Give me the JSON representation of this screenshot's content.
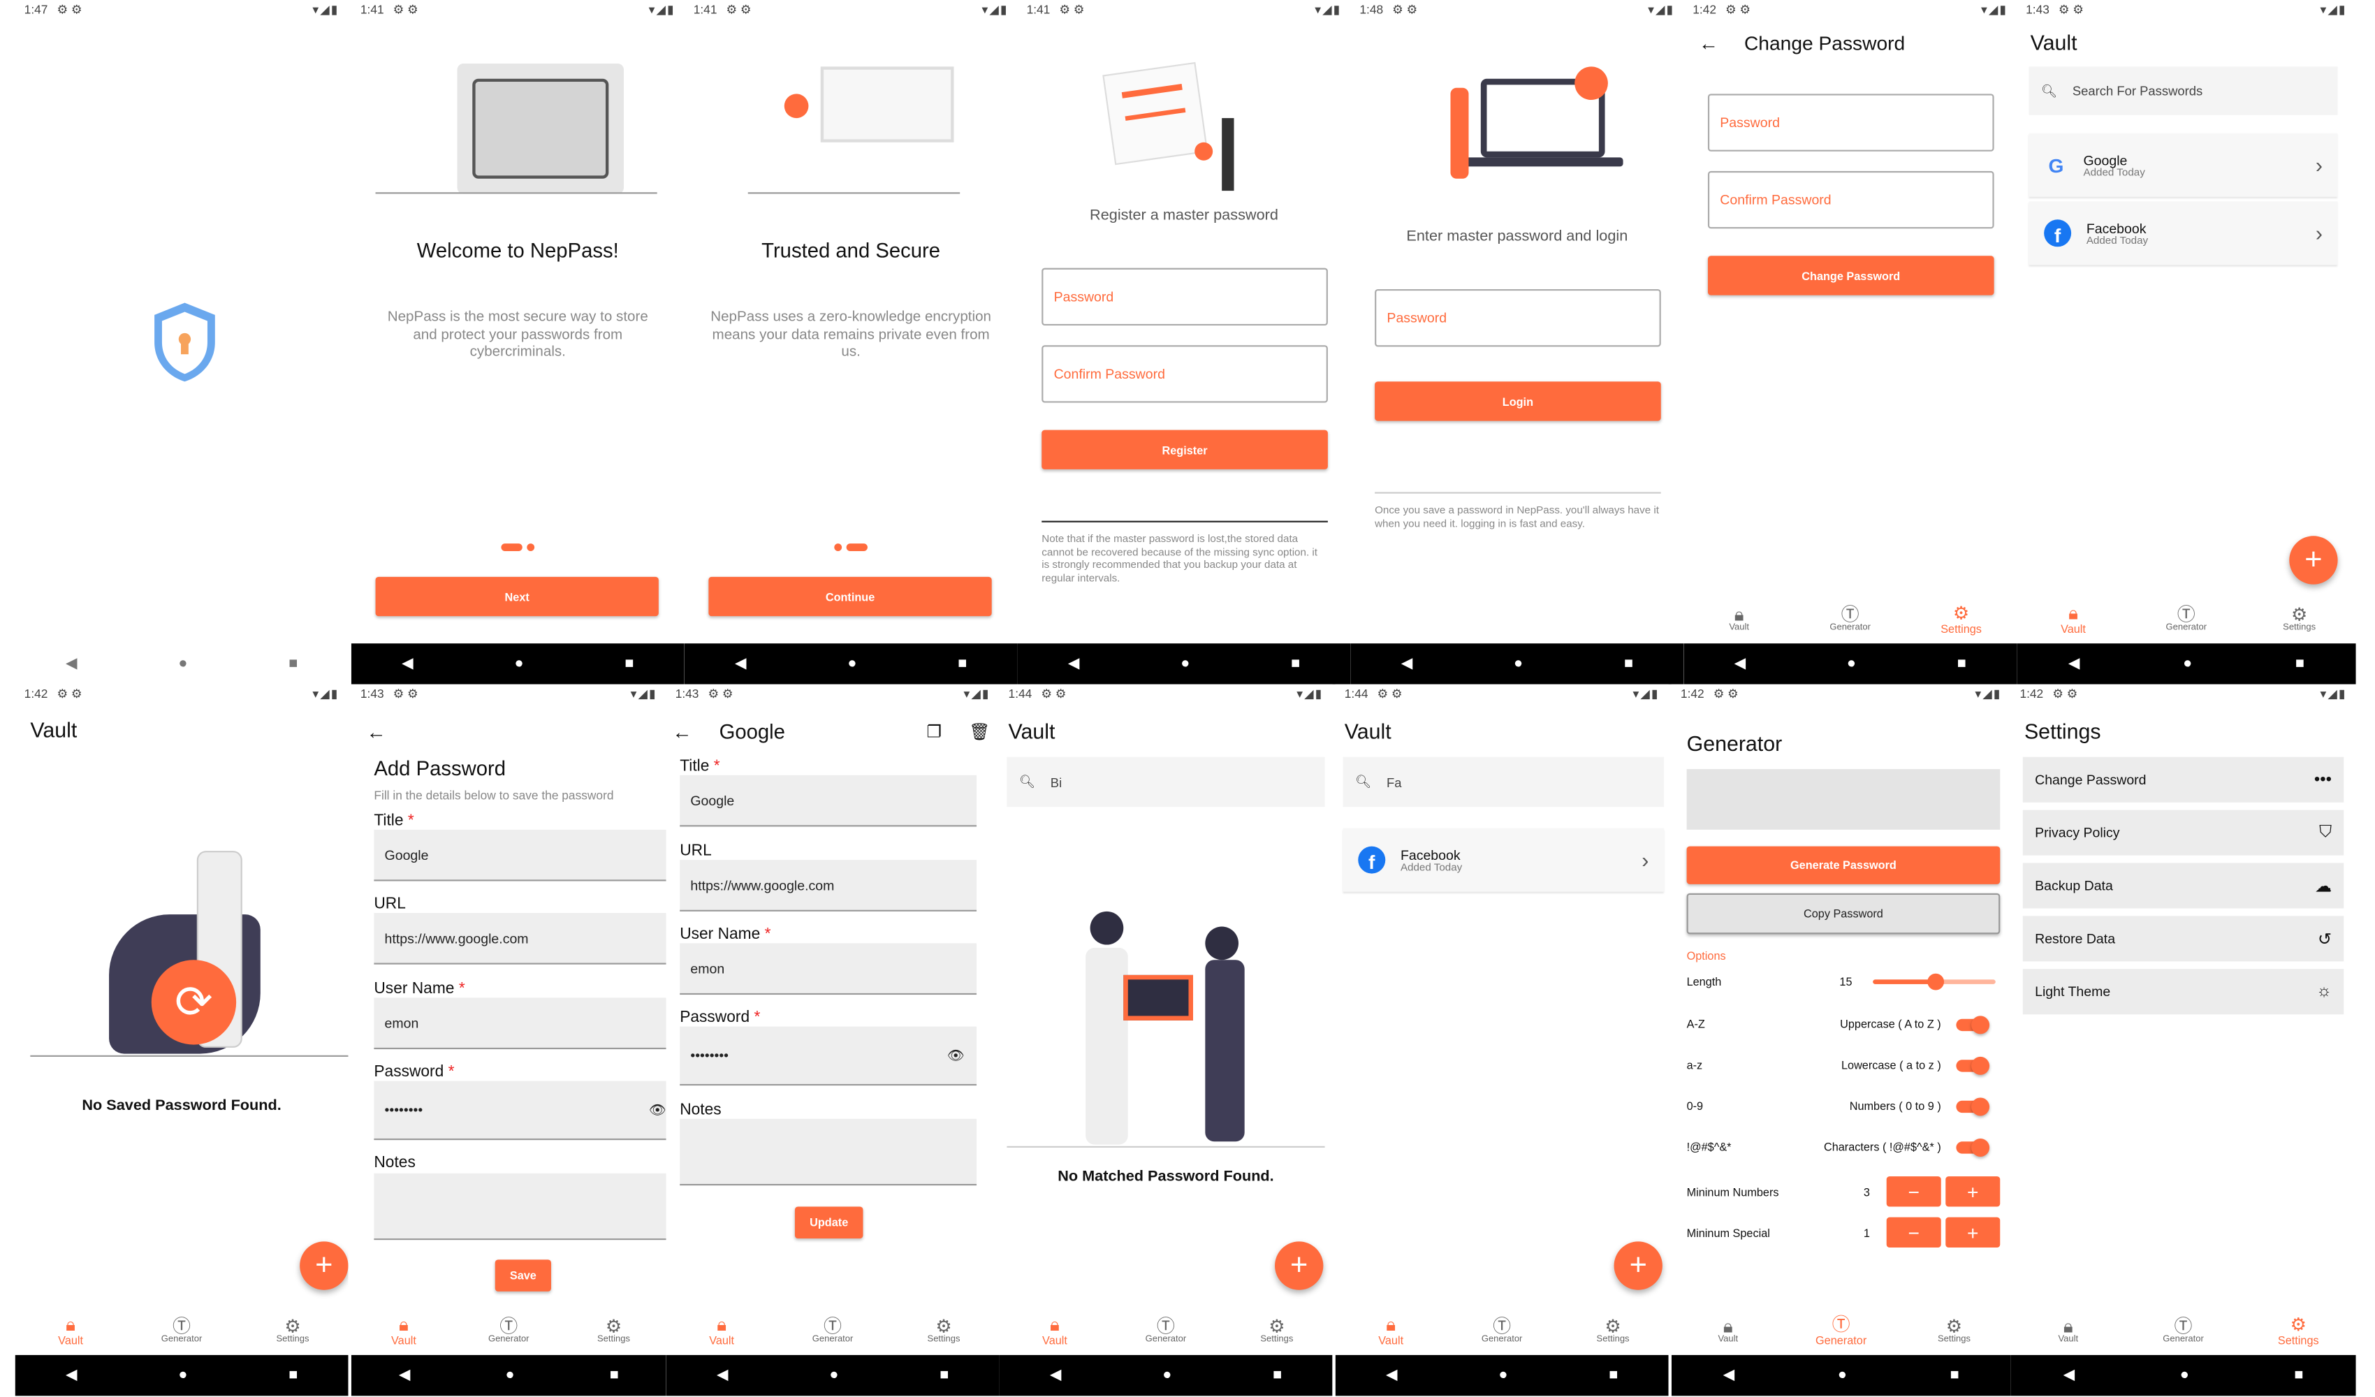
{
  "brand": {
    "accent": "#ff6b3d"
  },
  "nav": {
    "vault": "Vault",
    "generator": "Generator",
    "settings": "Settings"
  },
  "splash": {
    "time": "1:47"
  },
  "welcome": {
    "time": "1:41",
    "title": "Welcome to NepPass!",
    "desc": "NepPass is the most secure way to store and protect your passwords from cybercriminals.",
    "button": "Next"
  },
  "trusted": {
    "time": "1:41",
    "title": "Trusted and Secure",
    "desc": "NepPass uses a zero-knowledge encryption means your data remains private even from us.",
    "button": "Continue"
  },
  "register": {
    "time": "1:41",
    "heading": "Register a master password",
    "password_ph": "Password",
    "confirm_ph": "Confirm Password",
    "button": "Register",
    "note": "Note that if the master password is lost,the stored data cannot be recovered because of the missing sync option. it is strongly recommended that you backup your  data at regular intervals."
  },
  "login": {
    "time": "1:48",
    "heading": "Enter master password and login",
    "password_ph": "Password",
    "button": "Login",
    "note": "Once you save a password in NepPass. you'll always have it when you need it. logging in is fast and easy."
  },
  "change": {
    "time": "1:42",
    "title": "Change Password",
    "password_ph": "Password",
    "confirm_ph": "Confirm Password",
    "button": "Change Password"
  },
  "vault": {
    "time": "1:43",
    "title": "Vault",
    "search_ph": "Search For Passwords",
    "items": [
      {
        "name": "Google",
        "sub": "Added Today"
      },
      {
        "name": "Facebook",
        "sub": "Added Today"
      }
    ]
  },
  "vault_empty": {
    "time": "1:42",
    "title": "Vault",
    "empty": "No Saved Password Found."
  },
  "add": {
    "time": "1:43",
    "title": "Add Password",
    "subtitle": "Fill in the details below to save the password",
    "title_label": "Title",
    "url_label": "URL",
    "user_label": "User Name",
    "password_label": "Password",
    "notes_label": "Notes",
    "title_value": "Google",
    "url_value": "https://www.google.com",
    "user_value": "emon",
    "password_value": "••••••••",
    "button": "Save"
  },
  "edit": {
    "time": "1:43",
    "title": "Google",
    "title_label": "Title",
    "url_label": "URL",
    "user_label": "User Name",
    "password_label": "Password",
    "notes_label": "Notes",
    "title_value": "Google",
    "url_value": "https://www.google.com",
    "user_value": "emon",
    "password_value": "••••••••",
    "button": "Update"
  },
  "search_none": {
    "time": "1:44",
    "title": "Vault",
    "query": "Bi",
    "empty": "No Matched Password Found."
  },
  "search_fa": {
    "time": "1:44",
    "title": "Vault",
    "query": "Fa",
    "items": [
      {
        "name": "Facebook",
        "sub": "Added Today"
      }
    ]
  },
  "generator": {
    "time": "1:42",
    "title": "Generator",
    "generate": "Generate Password",
    "copy": "Copy Password",
    "options": "Options",
    "length_label": "Length",
    "length": "15",
    "length_fraction": 0.5,
    "toggles": [
      {
        "short": "A-Z",
        "label": "Uppercase ( A to Z )",
        "on": true
      },
      {
        "short": "a-z",
        "label": "Lowercase ( a to z )",
        "on": true
      },
      {
        "short": "0-9",
        "label": "Numbers ( 0 to 9 )",
        "on": true
      },
      {
        "short": "!@#$^&*",
        "label": "Characters ( !@#$^&* )",
        "on": true
      }
    ],
    "min_numbers_label": "Mininum Numbers",
    "min_numbers": "3",
    "min_special_label": "Mininum Special",
    "min_special": "1"
  },
  "settings": {
    "time": "1:42",
    "title": "Settings",
    "items": [
      "Change Password",
      "Privacy Policy",
      "Backup Data",
      "Restore Data",
      "Light Theme"
    ]
  }
}
